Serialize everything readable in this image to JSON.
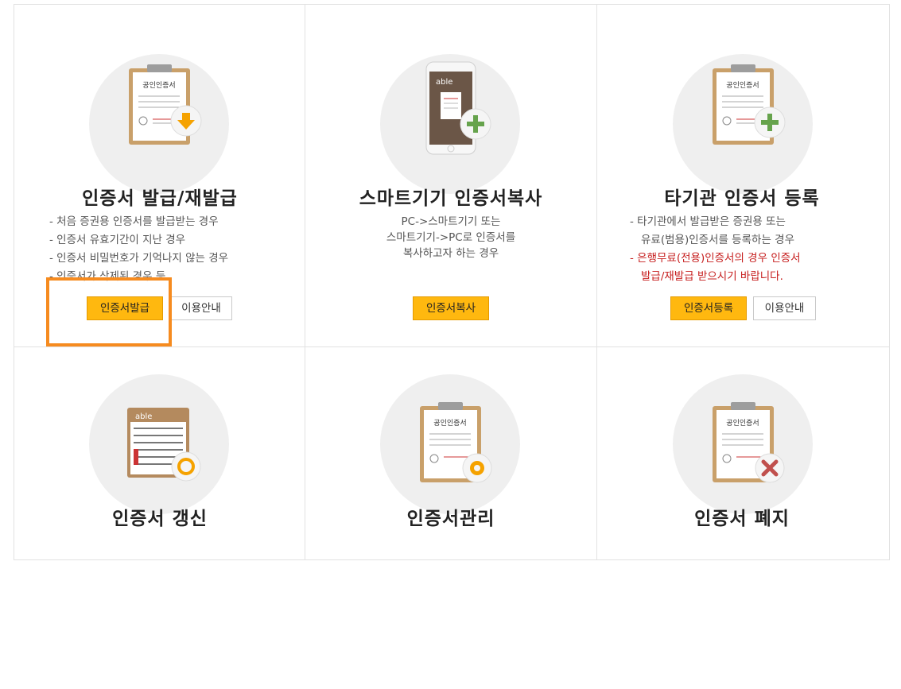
{
  "cards": [
    {
      "title": "인증서 발급/재발급",
      "desc": [
        "- 처음 증권용 인증서를 발급받는 경우",
        "- 인증서 유효기간이 지난 경우",
        "- 인증서 비밀번호가 기억나지 않는 경우",
        "- 인증서가 삭제된 경우 등"
      ],
      "primary_button": "인증서발급",
      "secondary_button": "이용안내",
      "icon": "certificate-download-icon"
    },
    {
      "title": "스마트기기 인증서복사",
      "desc": [
        "PC->스마트기기 또는",
        "스마트기기->PC로 인증서를",
        "복사하고자 하는 경우"
      ],
      "primary_button": "인증서복사",
      "icon": "smartphone-add-icon",
      "phone_brand": "able"
    },
    {
      "title": "타기관 인증서 등록",
      "desc": [
        "- 타기관에서 발급받은 증권용 또는",
        "유료(범용)인증서를 등록하는 경우"
      ],
      "desc_red": [
        "- 은행무료(전용)인증서의 경우 인증서",
        "발급/재발급 받으시기 바랍니다."
      ],
      "primary_button": "인증서등록",
      "secondary_button": "이용안내",
      "icon": "certificate-add-icon"
    },
    {
      "title": "인증서 갱신",
      "icon": "calendar-renew-icon",
      "calendar_brand": "able"
    },
    {
      "title": "인증서관리",
      "icon": "certificate-settings-icon"
    },
    {
      "title": "인증서 폐지",
      "icon": "certificate-delete-icon"
    }
  ],
  "clipboard_title": "공인인증서",
  "colors": {
    "accent": "#ffb80f",
    "highlight": "#f68b1f",
    "warning_text": "#c61d1d"
  }
}
